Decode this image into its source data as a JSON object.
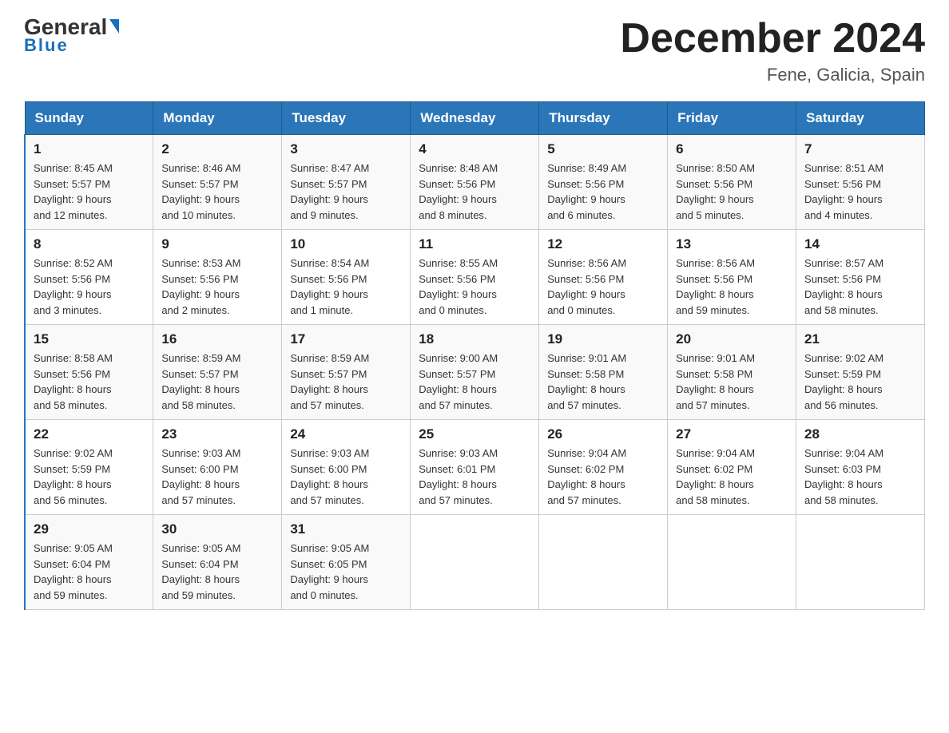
{
  "header": {
    "logo_general": "General",
    "logo_blue": "Blue",
    "month_title": "December 2024",
    "location": "Fene, Galicia, Spain"
  },
  "weekdays": [
    "Sunday",
    "Monday",
    "Tuesday",
    "Wednesday",
    "Thursday",
    "Friday",
    "Saturday"
  ],
  "weeks": [
    [
      {
        "day": "1",
        "sunrise": "8:45 AM",
        "sunset": "5:57 PM",
        "daylight": "9 hours and 12 minutes."
      },
      {
        "day": "2",
        "sunrise": "8:46 AM",
        "sunset": "5:57 PM",
        "daylight": "9 hours and 10 minutes."
      },
      {
        "day": "3",
        "sunrise": "8:47 AM",
        "sunset": "5:57 PM",
        "daylight": "9 hours and 9 minutes."
      },
      {
        "day": "4",
        "sunrise": "8:48 AM",
        "sunset": "5:56 PM",
        "daylight": "9 hours and 8 minutes."
      },
      {
        "day": "5",
        "sunrise": "8:49 AM",
        "sunset": "5:56 PM",
        "daylight": "9 hours and 6 minutes."
      },
      {
        "day": "6",
        "sunrise": "8:50 AM",
        "sunset": "5:56 PM",
        "daylight": "9 hours and 5 minutes."
      },
      {
        "day": "7",
        "sunrise": "8:51 AM",
        "sunset": "5:56 PM",
        "daylight": "9 hours and 4 minutes."
      }
    ],
    [
      {
        "day": "8",
        "sunrise": "8:52 AM",
        "sunset": "5:56 PM",
        "daylight": "9 hours and 3 minutes."
      },
      {
        "day": "9",
        "sunrise": "8:53 AM",
        "sunset": "5:56 PM",
        "daylight": "9 hours and 2 minutes."
      },
      {
        "day": "10",
        "sunrise": "8:54 AM",
        "sunset": "5:56 PM",
        "daylight": "9 hours and 1 minute."
      },
      {
        "day": "11",
        "sunrise": "8:55 AM",
        "sunset": "5:56 PM",
        "daylight": "9 hours and 0 minutes."
      },
      {
        "day": "12",
        "sunrise": "8:56 AM",
        "sunset": "5:56 PM",
        "daylight": "9 hours and 0 minutes."
      },
      {
        "day": "13",
        "sunrise": "8:56 AM",
        "sunset": "5:56 PM",
        "daylight": "8 hours and 59 minutes."
      },
      {
        "day": "14",
        "sunrise": "8:57 AM",
        "sunset": "5:56 PM",
        "daylight": "8 hours and 58 minutes."
      }
    ],
    [
      {
        "day": "15",
        "sunrise": "8:58 AM",
        "sunset": "5:56 PM",
        "daylight": "8 hours and 58 minutes."
      },
      {
        "day": "16",
        "sunrise": "8:59 AM",
        "sunset": "5:57 PM",
        "daylight": "8 hours and 58 minutes."
      },
      {
        "day": "17",
        "sunrise": "8:59 AM",
        "sunset": "5:57 PM",
        "daylight": "8 hours and 57 minutes."
      },
      {
        "day": "18",
        "sunrise": "9:00 AM",
        "sunset": "5:57 PM",
        "daylight": "8 hours and 57 minutes."
      },
      {
        "day": "19",
        "sunrise": "9:01 AM",
        "sunset": "5:58 PM",
        "daylight": "8 hours and 57 minutes."
      },
      {
        "day": "20",
        "sunrise": "9:01 AM",
        "sunset": "5:58 PM",
        "daylight": "8 hours and 57 minutes."
      },
      {
        "day": "21",
        "sunrise": "9:02 AM",
        "sunset": "5:59 PM",
        "daylight": "8 hours and 56 minutes."
      }
    ],
    [
      {
        "day": "22",
        "sunrise": "9:02 AM",
        "sunset": "5:59 PM",
        "daylight": "8 hours and 56 minutes."
      },
      {
        "day": "23",
        "sunrise": "9:03 AM",
        "sunset": "6:00 PM",
        "daylight": "8 hours and 57 minutes."
      },
      {
        "day": "24",
        "sunrise": "9:03 AM",
        "sunset": "6:00 PM",
        "daylight": "8 hours and 57 minutes."
      },
      {
        "day": "25",
        "sunrise": "9:03 AM",
        "sunset": "6:01 PM",
        "daylight": "8 hours and 57 minutes."
      },
      {
        "day": "26",
        "sunrise": "9:04 AM",
        "sunset": "6:02 PM",
        "daylight": "8 hours and 57 minutes."
      },
      {
        "day": "27",
        "sunrise": "9:04 AM",
        "sunset": "6:02 PM",
        "daylight": "8 hours and 58 minutes."
      },
      {
        "day": "28",
        "sunrise": "9:04 AM",
        "sunset": "6:03 PM",
        "daylight": "8 hours and 58 minutes."
      }
    ],
    [
      {
        "day": "29",
        "sunrise": "9:05 AM",
        "sunset": "6:04 PM",
        "daylight": "8 hours and 59 minutes."
      },
      {
        "day": "30",
        "sunrise": "9:05 AM",
        "sunset": "6:04 PM",
        "daylight": "8 hours and 59 minutes."
      },
      {
        "day": "31",
        "sunrise": "9:05 AM",
        "sunset": "6:05 PM",
        "daylight": "9 hours and 0 minutes."
      },
      null,
      null,
      null,
      null
    ]
  ],
  "labels": {
    "sunrise": "Sunrise:",
    "sunset": "Sunset:",
    "daylight": "Daylight:"
  }
}
